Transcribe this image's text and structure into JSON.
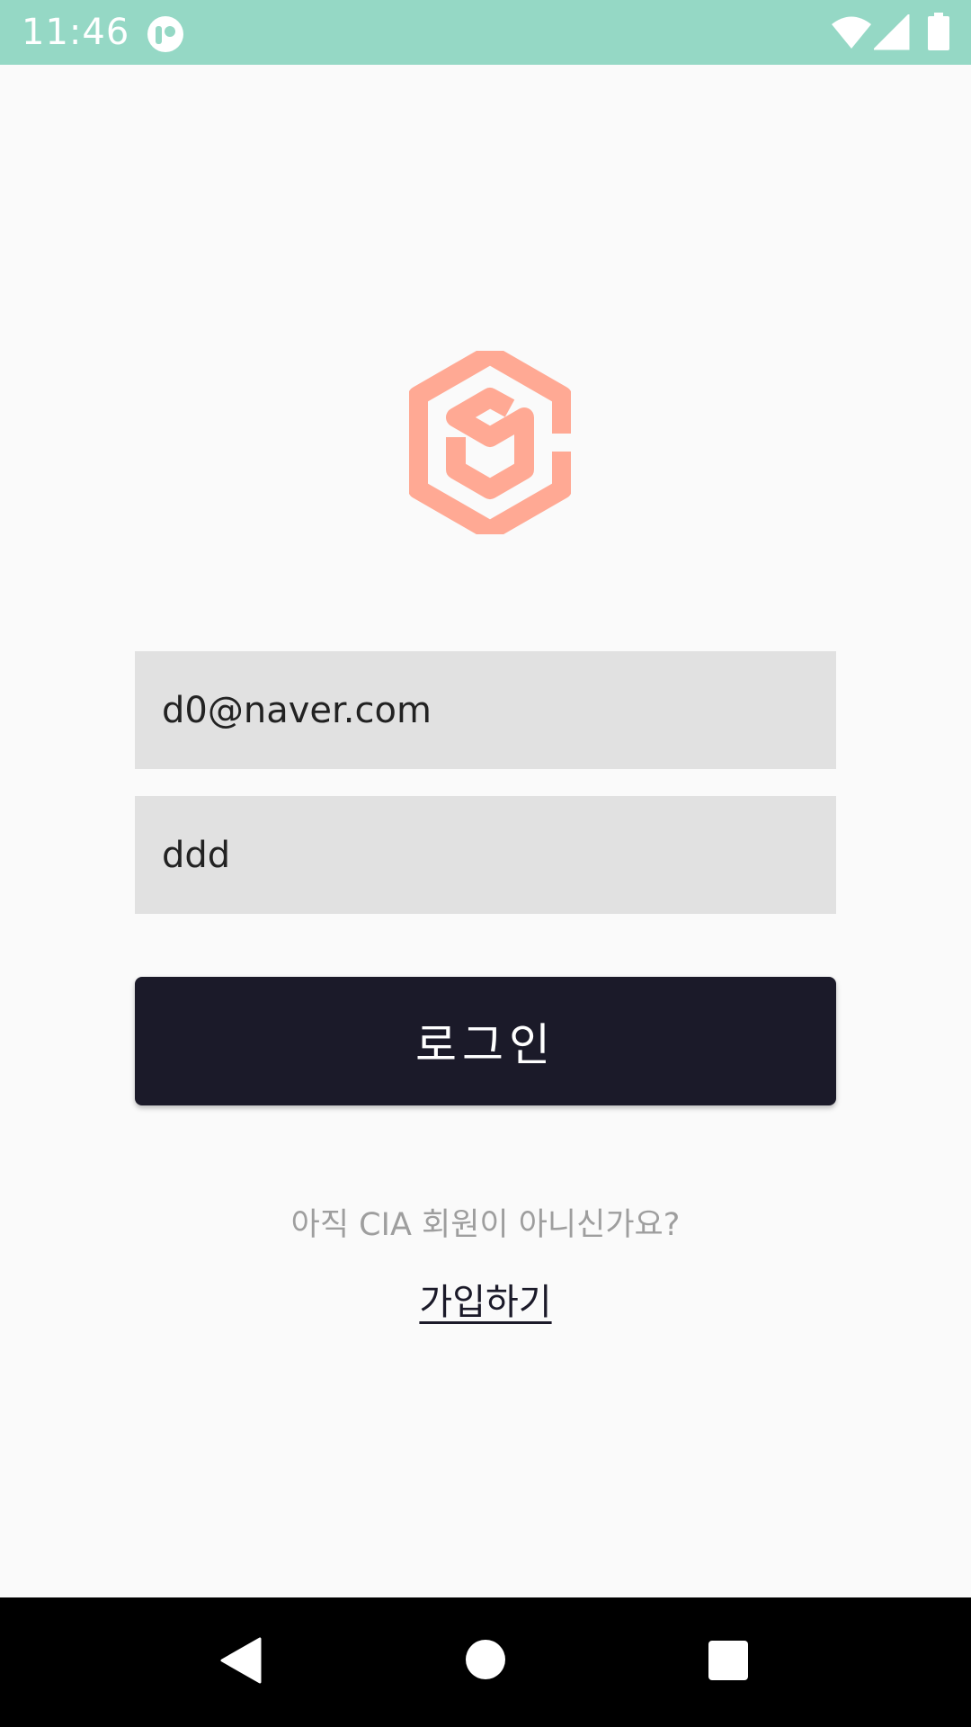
{
  "status_bar": {
    "time": "11:46",
    "background_color": "#95d8c5",
    "icons": [
      "app-notification-icon",
      "wifi-icon",
      "cell-signal-icon",
      "battery-icon"
    ]
  },
  "logo": {
    "icon": "cube-logo-icon",
    "color": "#ffa994"
  },
  "form": {
    "email_value": "d0@naver.com",
    "password_value": "ddd",
    "login_label": "로그인"
  },
  "signup": {
    "prompt": "아직 CIA 회원이 아니신가요?",
    "link_label": "가입하기"
  },
  "nav_bar": {
    "icons": [
      "back-icon",
      "home-icon",
      "recents-icon"
    ]
  },
  "colors": {
    "accent_dark": "#1b1a29",
    "field_bg": "#e1e1e1",
    "page_bg": "#fafafa"
  }
}
